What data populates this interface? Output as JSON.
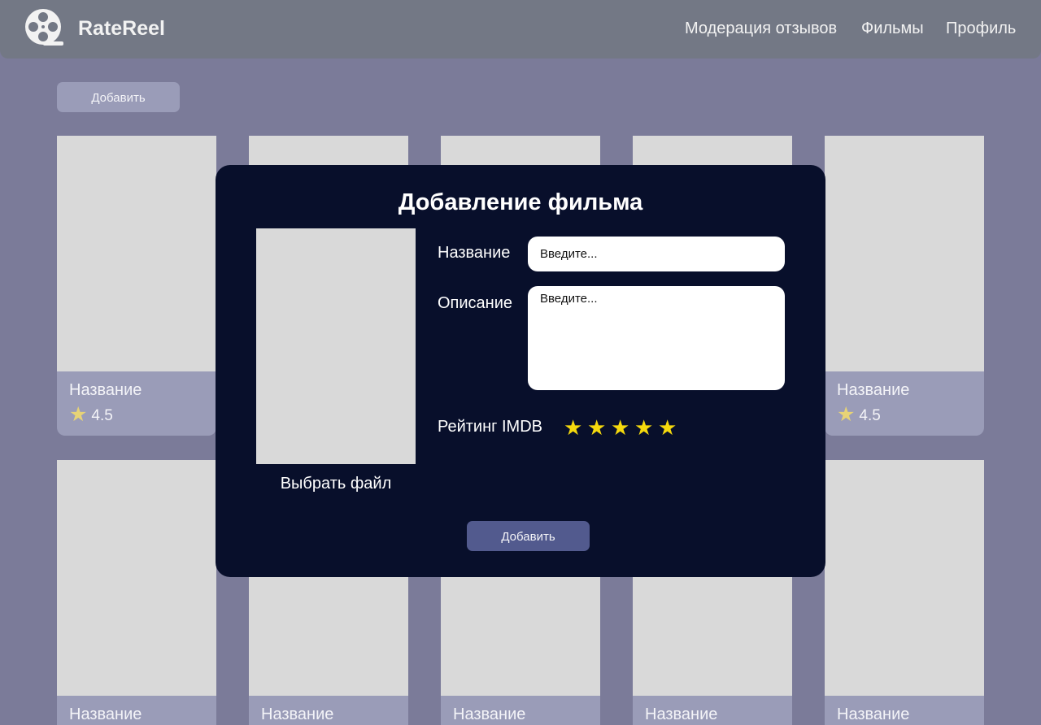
{
  "header": {
    "brand": "RateReel",
    "logo_icon": "film-reel-icon",
    "nav": [
      {
        "label": "Модерация отзывов"
      },
      {
        "label": "Фильмы"
      },
      {
        "label": "Профиль"
      }
    ]
  },
  "toolbar": {
    "add_label": "Добавить"
  },
  "grid": {
    "cards": [
      {
        "title": "Название",
        "rating": "4.5"
      },
      {
        "title": "Название",
        "rating": "4.5"
      },
      {
        "title": "Название"
      },
      {
        "title": "Название"
      },
      {
        "title": "Название"
      },
      {
        "title": "Название"
      },
      {
        "title": "Название"
      }
    ],
    "star_icon": "star-icon",
    "star_color": "#e7d376"
  },
  "modal": {
    "title": "Добавление фильма",
    "choose_file_label": "Выбрать файл",
    "name_label": "Название",
    "name_placeholder": "Введите...",
    "description_label": "Описание",
    "description_placeholder": "Введите...",
    "rating_label": "Рейтинг IMDB",
    "rating_stars": 5,
    "rating_star_color": "#f5d90d",
    "add_label": "Добавить"
  },
  "colors": {
    "background": "#7b7b99",
    "header": "#737885",
    "modal": "#080f2b",
    "card_info": "#9a9cb8",
    "primary_button": "#525a8e"
  }
}
